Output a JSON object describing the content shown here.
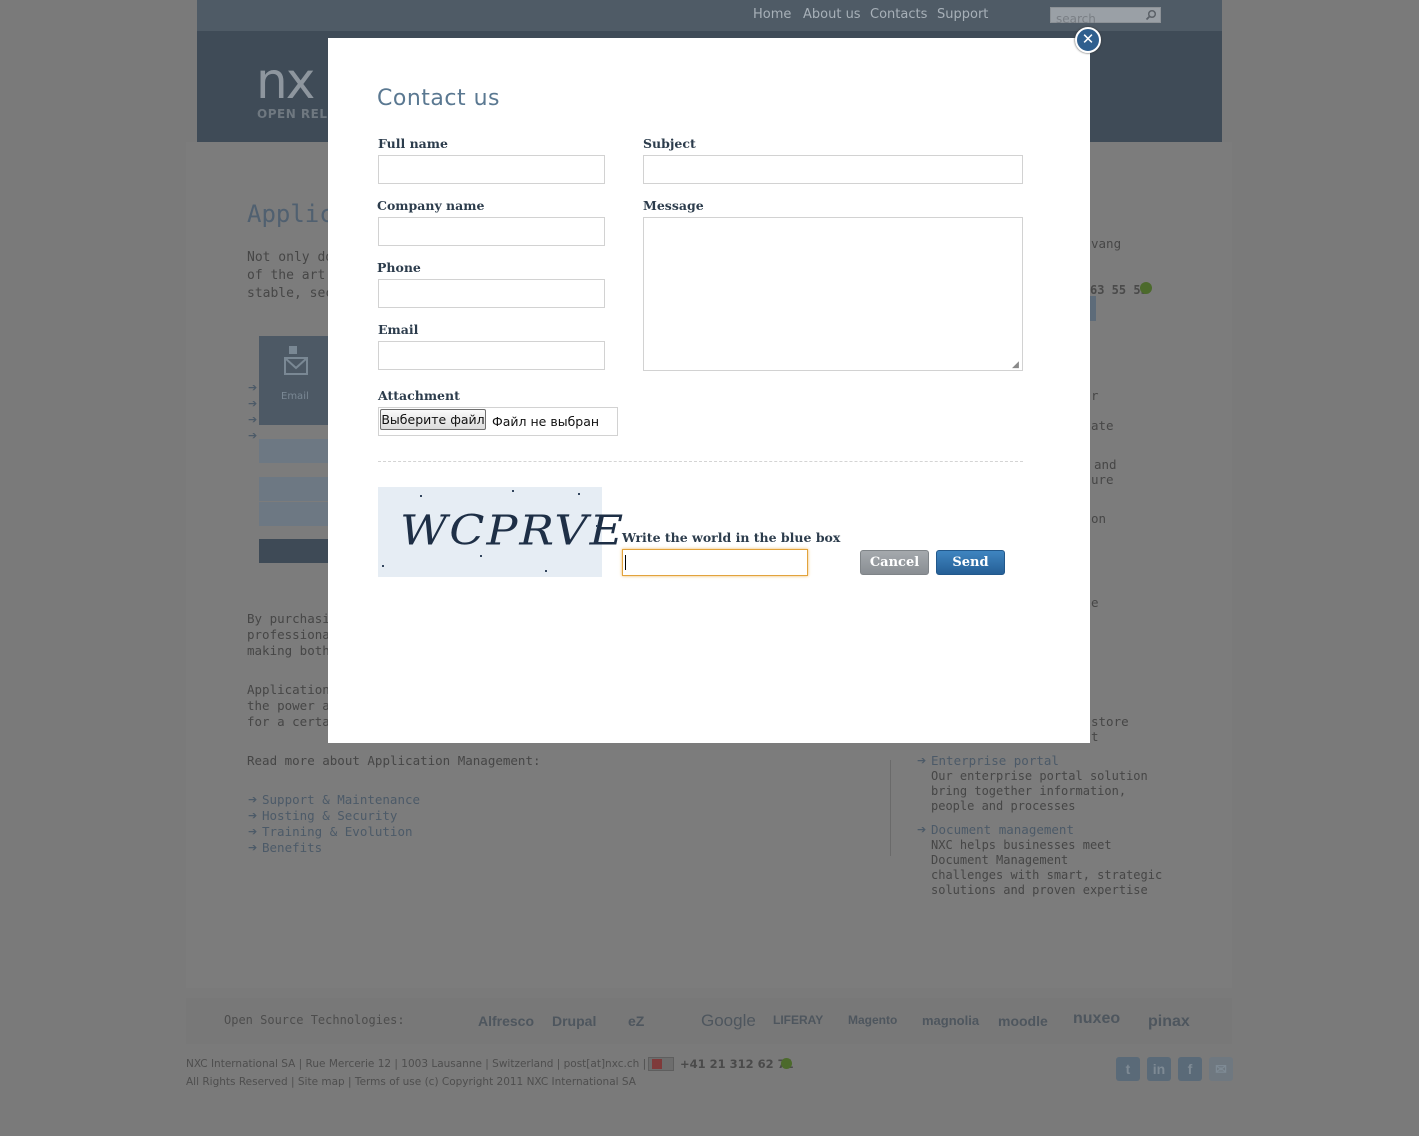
{
  "nav": {
    "home": "Home",
    "about": "About us",
    "contacts": "Contacts",
    "support": "Support",
    "search_placeholder": "search"
  },
  "brand": {
    "logo": "nx",
    "tagline": "OPEN RELIA"
  },
  "page": {
    "heading": "Applica",
    "intro_lines": [
      "Not only do",
      "of the art A",
      "stable, secu"
    ],
    "email_tile": "Email",
    "purchase_lines": [
      "By purchasing",
      "professionals.",
      "making both s"
    ],
    "am_lines": [
      "Application Ma",
      "the power and",
      "for a certain r"
    ],
    "read_more": "Read more about Application Management:",
    "links": [
      "Support & Maintenance",
      "Hosting & Security",
      "Training & Evolution",
      "Benefits"
    ]
  },
  "sidebar": {
    "fragments": [
      "vang",
      "63 55 55",
      "r",
      "ate",
      "and",
      "ure",
      "on",
      "e",
      "store",
      "t"
    ],
    "enterprise_portal": {
      "title": "Enterprise portal",
      "desc": [
        "Our enterprise portal solution",
        "bring together information,",
        "people and processes"
      ]
    },
    "document_management": {
      "title": "Document management",
      "desc": [
        "NXC helps businesses meet",
        "Document Management",
        "challenges with smart, strategic",
        "solutions and proven expertise"
      ]
    }
  },
  "footer": {
    "os_label": "Open Source Technologies:",
    "tech_logos": [
      "Alfresco",
      "Drupal",
      "eZ",
      "Google",
      "LIFERAY",
      "Magento",
      "magnolia",
      "moodle",
      "nuxeo",
      "pinax"
    ],
    "address": "NXC International SA  |  Rue Mercerie 12  |  1003 Lausanne  |  Switzerland  |  post[at]nxc.ch  |",
    "phone": "+41 21 312 62 71",
    "legal": "All Rights Reserved  |  Site map  |  Terms of use (c) Copyright 2011 NXC International SA",
    "social": [
      "twitter-icon",
      "linkedin-icon",
      "facebook-icon",
      "mail-icon"
    ]
  },
  "modal": {
    "title": "Contact us",
    "close_icon": "close-icon",
    "labels": {
      "full_name": "Full name",
      "company_name": "Company name",
      "phone": "Phone",
      "email": "Email",
      "subject": "Subject",
      "message": "Message",
      "attachment": "Attachment",
      "captcha": "Write the world in the blue box"
    },
    "values": {
      "full_name": "",
      "company_name": "",
      "phone": "",
      "email": "",
      "subject": "",
      "message": "",
      "captcha": ""
    },
    "file_button": "Выберите файл",
    "file_status": "Файл не выбран",
    "captcha_text": "WCPRVE",
    "cancel": "Cancel",
    "send": "Send"
  },
  "colors": {
    "accent": "#2f6aa1",
    "title": "#5a7891",
    "overlay": "#7a7a7a"
  }
}
